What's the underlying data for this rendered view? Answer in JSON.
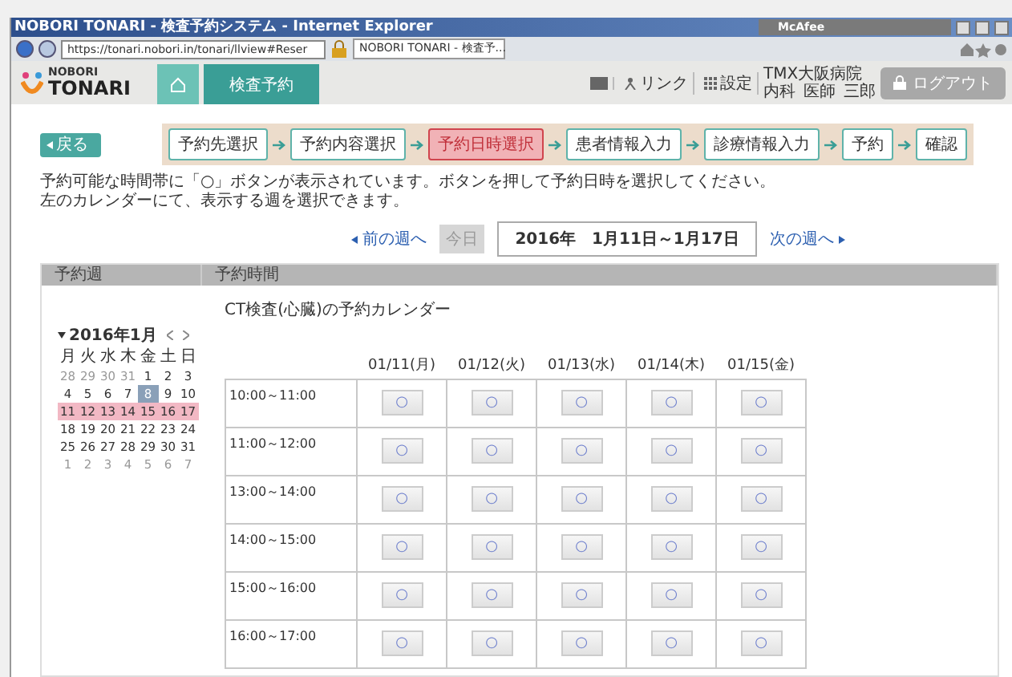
{
  "browser": {
    "title": "NOBORI TONARI - 検査予約システム - Internet Explorer",
    "addon": "McAfee",
    "url": "https://tonari.nobori.in/tonari/llview#Reser",
    "tab_title": "NOBORI TONARI - 検査予..."
  },
  "header": {
    "logo_top": "NOBORI",
    "logo_bottom": "TONARI",
    "nav": [
      {
        "label": "検査予約",
        "selected": true
      }
    ],
    "links": [
      {
        "kind": "mail"
      },
      {
        "kind": "link",
        "label": "リンク"
      },
      {
        "kind": "settings",
        "label": "設定"
      }
    ],
    "hospital": "TMX大阪病院",
    "user": [
      "内科",
      "医師",
      "三郎"
    ],
    "logout": "ログアウト"
  },
  "back": "戻る",
  "steps": [
    {
      "label": "予約先選択",
      "selected": false
    },
    {
      "label": "予約内容選択",
      "selected": false
    },
    {
      "label": "予約日時選択",
      "selected": true
    },
    {
      "label": "患者情報入力",
      "selected": false
    },
    {
      "label": "診療情報入力",
      "selected": false
    },
    {
      "label": "予約",
      "selected": false
    },
    {
      "label": "確認",
      "selected": false
    }
  ],
  "instructions": [
    "予約可能な時間帯に「○」ボタンが表示されています。ボタンを押して予約日時を選択してください。",
    "左のカレンダーにて、表示する週を選択できます。"
  ],
  "week_nav": {
    "prev": "前の週へ",
    "today": {
      "label": "今日",
      "disabled": true
    },
    "range": "2016年　1月11日～1月17日",
    "next": "次の週へ"
  },
  "panel": {
    "left_heading": "予約週",
    "right_heading": "予約時間"
  },
  "mini_calendar": {
    "title": "2016年1月",
    "weekdays": [
      "月",
      "火",
      "水",
      "木",
      "金",
      "土",
      "日"
    ],
    "weeks": [
      {
        "selected": false,
        "days": [
          {
            "label": "28",
            "muted": true,
            "today": false
          },
          {
            "label": "29",
            "muted": true,
            "today": false
          },
          {
            "label": "30",
            "muted": true,
            "today": false
          },
          {
            "label": "31",
            "muted": true,
            "today": false
          },
          {
            "label": "1",
            "muted": false,
            "today": false
          },
          {
            "label": "2",
            "muted": false,
            "today": false
          },
          {
            "label": "3",
            "muted": false,
            "today": false
          }
        ]
      },
      {
        "selected": false,
        "days": [
          {
            "label": "4",
            "muted": false,
            "today": false
          },
          {
            "label": "5",
            "muted": false,
            "today": false
          },
          {
            "label": "6",
            "muted": false,
            "today": false
          },
          {
            "label": "7",
            "muted": false,
            "today": false
          },
          {
            "label": "8",
            "muted": false,
            "today": true
          },
          {
            "label": "9",
            "muted": false,
            "today": false
          },
          {
            "label": "10",
            "muted": false,
            "today": false
          }
        ]
      },
      {
        "selected": true,
        "days": [
          {
            "label": "11",
            "muted": false,
            "today": false
          },
          {
            "label": "12",
            "muted": false,
            "today": false
          },
          {
            "label": "13",
            "muted": false,
            "today": false
          },
          {
            "label": "14",
            "muted": false,
            "today": false
          },
          {
            "label": "15",
            "muted": false,
            "today": false
          },
          {
            "label": "16",
            "muted": false,
            "today": false
          },
          {
            "label": "17",
            "muted": false,
            "today": false
          }
        ]
      },
      {
        "selected": false,
        "days": [
          {
            "label": "18",
            "muted": false,
            "today": false
          },
          {
            "label": "19",
            "muted": false,
            "today": false
          },
          {
            "label": "20",
            "muted": false,
            "today": false
          },
          {
            "label": "21",
            "muted": false,
            "today": false
          },
          {
            "label": "22",
            "muted": false,
            "today": false
          },
          {
            "label": "23",
            "muted": false,
            "today": false
          },
          {
            "label": "24",
            "muted": false,
            "today": false
          }
        ]
      },
      {
        "selected": false,
        "days": [
          {
            "label": "25",
            "muted": false,
            "today": false
          },
          {
            "label": "26",
            "muted": false,
            "today": false
          },
          {
            "label": "27",
            "muted": false,
            "today": false
          },
          {
            "label": "28",
            "muted": false,
            "today": false
          },
          {
            "label": "29",
            "muted": false,
            "today": false
          },
          {
            "label": "30",
            "muted": false,
            "today": false
          },
          {
            "label": "31",
            "muted": false,
            "today": false
          }
        ]
      },
      {
        "selected": false,
        "days": [
          {
            "label": "1",
            "muted": true,
            "today": false
          },
          {
            "label": "2",
            "muted": true,
            "today": false
          },
          {
            "label": "3",
            "muted": true,
            "today": false
          },
          {
            "label": "4",
            "muted": true,
            "today": false
          },
          {
            "label": "5",
            "muted": true,
            "today": false
          },
          {
            "label": "6",
            "muted": true,
            "today": false
          },
          {
            "label": "7",
            "muted": true,
            "today": false
          }
        ]
      }
    ]
  },
  "schedule": {
    "title": "CT検査(心臓)の予約カレンダー",
    "days": [
      "01/11(月)",
      "01/12(火)",
      "01/13(水)",
      "01/14(木)",
      "01/15(金)"
    ],
    "rows": [
      {
        "time": "10:00～11:00",
        "slots": [
          "○",
          "○",
          "○",
          "○",
          "○"
        ]
      },
      {
        "time": "11:00～12:00",
        "slots": [
          "○",
          "○",
          "○",
          "○",
          "○"
        ]
      },
      {
        "time": "13:00～14:00",
        "slots": [
          "○",
          "○",
          "○",
          "○",
          "○"
        ]
      },
      {
        "time": "14:00～15:00",
        "slots": [
          "○",
          "○",
          "○",
          "○",
          "○"
        ]
      },
      {
        "time": "15:00～16:00",
        "slots": [
          "○",
          "○",
          "○",
          "○",
          "○"
        ]
      },
      {
        "time": "16:00～17:00",
        "slots": [
          "○",
          "○",
          "○",
          "○",
          "○"
        ]
      }
    ]
  }
}
